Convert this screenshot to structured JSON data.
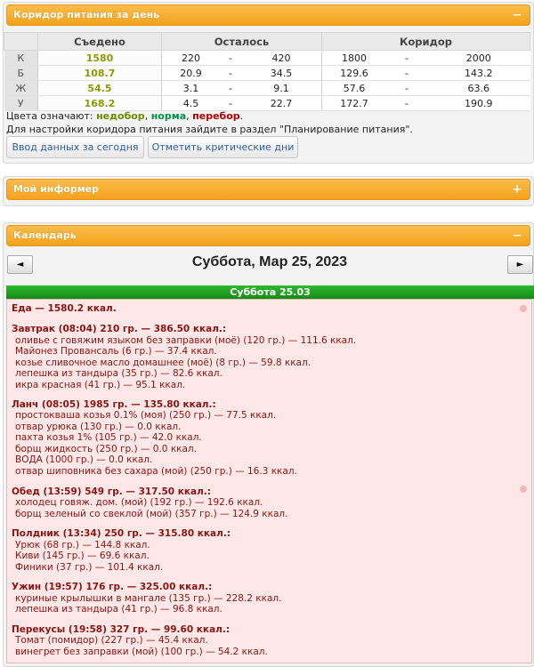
{
  "corridor_panel": {
    "title": "Коридор питания за день",
    "toggle": "−",
    "headers": {
      "eaten": "Съедено",
      "left": "Осталось",
      "corridor": "Коридор"
    },
    "rows": [
      {
        "label": "К",
        "eaten": "1580",
        "left_min": "220",
        "left_max": "420",
        "corr_min": "1800",
        "corr_max": "2000"
      },
      {
        "label": "Б",
        "eaten": "108.7",
        "left_min": "20.9",
        "left_max": "34.5",
        "corr_min": "129.6",
        "corr_max": "143.2"
      },
      {
        "label": "Ж",
        "eaten": "54.5",
        "left_min": "3.1",
        "left_max": "9.1",
        "corr_min": "57.6",
        "corr_max": "63.6"
      },
      {
        "label": "У",
        "eaten": "168.2",
        "left_min": "4.5",
        "left_max": "22.7",
        "corr_min": "172.7",
        "corr_max": "190.9"
      }
    ],
    "dash": "-",
    "legend_prefix": "Цвета означают: ",
    "legend_low": "недобор",
    "legend_norm": "норма",
    "legend_over": "перебор",
    "legend_sep": ", ",
    "legend_end": ".",
    "hint": "Для настройки коридора питания зайдите в раздел \"Планирование питания\".",
    "btn_input": "Ввод данных за сегодня",
    "btn_critical": "Отметить критические дни"
  },
  "informer_panel": {
    "title": "Мой информер",
    "toggle": "+"
  },
  "calendar_panel": {
    "title": "Календарь",
    "toggle": "−",
    "prev": "◄",
    "next": "►",
    "date_title": "Суббота, Мар 25, 2023",
    "day_header": "Суббота 25.03",
    "lines": [
      "Еда — 1580.2 ккал.",
      "Завтрак (08:04) 210 гр. — 386.50 ккал.:",
      "оливье с говяжим языком без заправки (моё) (120 гр.) — 111.6 ккал.",
      "Майонез Провансаль (6 гр.) — 37.4 ккал.",
      "козье сливочное масло домашнее (моё) (8 гр.) — 59.8 ккал.",
      "лепешка из тандыра (35 гр.) — 82.6 ккал.",
      "икра красная (41 гр.) — 95.1 ккал.",
      "Ланч (08:05) 1985 гр. — 135.80 ккал.:",
      "простокваша козья 0.1% (моя) (250 гр.) — 77.5 ккал.",
      "отвар урюка (130 гр.) — 0.0 ккал.",
      "пахта козья 1% (105 гр.) — 42.0 ккал.",
      "борщ жидкость (250 гр.) — 0.0 ккал.",
      "ВОДА (1000 гр.) — 0.0 ккал.",
      "отвар шиповника без сахара (мой) (250 гр.) — 16.3 ккал.",
      "Обед (13:59) 549 гр. — 317.50 ккал.:",
      "холодец говяж. дом. (мой) (192 гр.) — 192.6 ккал.",
      "борщ зеленый со свеклой (мой) (357 гр.) — 124.9 ккал.",
      "Полдник (13:34) 250 гр. — 315.80 ккал.:",
      "Урюк (68 гр.) — 144.8 ккал.",
      "Киви (145 гр.) — 69.6 ккал.",
      "Финики (37 гр.) — 101.4 ккал.",
      "Ужин (19:57) 176 гр. — 325.00 ккал.:",
      "куриные крылышки в мангале (135 гр.) — 228.2 ккал.",
      "лепешка из тандыра (41 гр.) — 96.8 ккал.",
      "Перекусы (19:58) 327 гр. — 99.60 ккал.:",
      "Томат (помидор) (227 гр.) — 45.4 ккал.",
      "винегрет без заправки (мой) (100 гр.) — 54.2 ккал."
    ]
  },
  "colors": {
    "orange": "#f4a21c",
    "green": "#138c13",
    "pink_bg": "#fde7e7",
    "dark_red": "#8b1414"
  }
}
